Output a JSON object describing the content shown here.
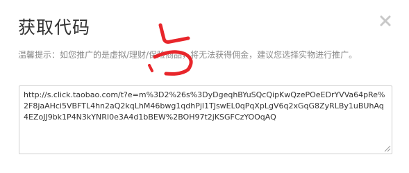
{
  "dialog": {
    "title": "获取代码",
    "close_icon": "close-icon",
    "tip": "温馨提示：如您推广的是虚拟/理财/保险商品，将无法获得佣金，建议您选择实物进行推广。",
    "code_value": "http://s.click.taobao.com/t?e=m%3D2%26s%3DyDgeqhBYuSQcQipKwQzePOeEDrYVVa64pRe%2F8jaAHci5VBFTL4hn2aQ2kqLhM46bwg1qdhPjl1TJswEL0qPqXpLgV6q2xGqG8ZyRLBy1uBUhAq4EZoJJ9bk1P4N3kYNRI0e3A4d1bBEW%2BOH97t2jKSGFCzYOOqAQ"
  },
  "colors": {
    "annotation": "#e8262b",
    "title": "#333333",
    "tip": "#8a8a8a",
    "border": "#cfcfcf"
  }
}
